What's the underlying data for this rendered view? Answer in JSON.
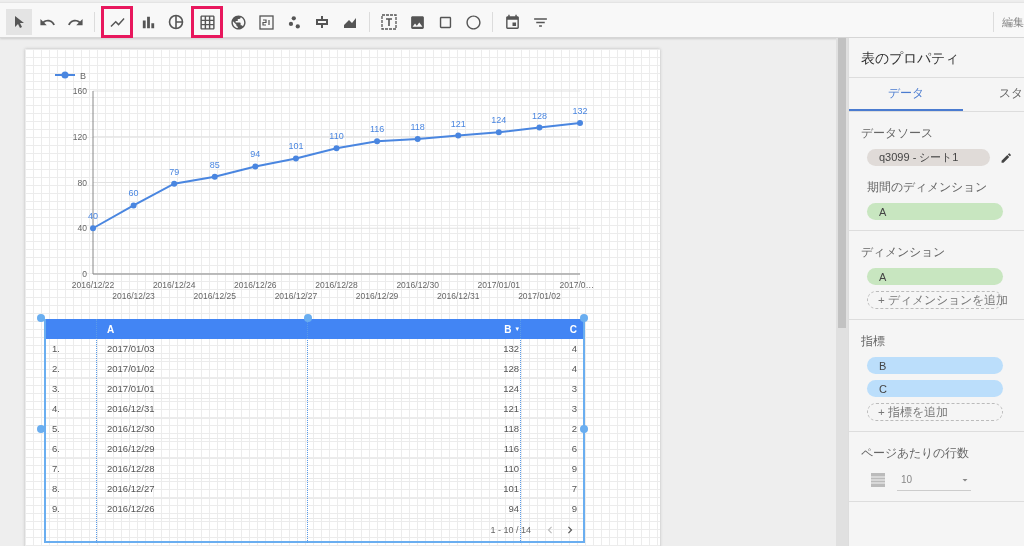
{
  "toolbar": {
    "groups": [
      [
        {
          "kind": "pointer",
          "selected": true,
          "highlighted": false
        },
        {
          "kind": "undo",
          "selected": false,
          "highlighted": false
        },
        {
          "kind": "redo",
          "selected": false,
          "highlighted": false
        }
      ],
      [
        {
          "kind": "line",
          "selected": false,
          "highlighted": true
        },
        {
          "kind": "bar",
          "selected": false,
          "highlighted": false
        },
        {
          "kind": "pie",
          "selected": false,
          "highlighted": false
        },
        {
          "kind": "table",
          "selected": false,
          "highlighted": true
        },
        {
          "kind": "geo",
          "selected": false,
          "highlighted": false
        },
        {
          "kind": "scorecard",
          "selected": false,
          "highlighted": false
        },
        {
          "kind": "scatter",
          "selected": false,
          "highlighted": false
        },
        {
          "kind": "bullet",
          "selected": false,
          "highlighted": false
        },
        {
          "kind": "area",
          "selected": false,
          "highlighted": false
        }
      ],
      [
        {
          "kind": "text",
          "selected": false,
          "highlighted": false
        },
        {
          "kind": "image",
          "selected": false,
          "highlighted": false
        },
        {
          "kind": "rectangle",
          "selected": false,
          "highlighted": false
        },
        {
          "kind": "circle",
          "selected": false,
          "highlighted": false
        }
      ],
      [
        {
          "kind": "date",
          "selected": false,
          "highlighted": false
        },
        {
          "kind": "filter",
          "selected": false,
          "highlighted": false
        }
      ]
    ],
    "edit_label": "編集"
  },
  "chart": {
    "chart_data": {
      "type": "line",
      "categories": [
        "2016/12/22",
        "2016/12/23",
        "2016/12/24",
        "2016/12/25",
        "2016/12/26",
        "2016/12/27",
        "2016/12/28",
        "2016/12/29",
        "2016/12/30",
        "2016/12/31",
        "2017/01/01",
        "2017/01/02",
        "2017/0…"
      ],
      "series": [
        {
          "name": "B",
          "color": "#4a86e0",
          "values": [
            40,
            60,
            79,
            85,
            94,
            101,
            110,
            116,
            118,
            121,
            124,
            128,
            132
          ]
        }
      ],
      "yticks": [
        0,
        40,
        80,
        120,
        160
      ],
      "ylim": [
        0,
        160
      ],
      "data_labels": true,
      "grid": true,
      "marker": true
    }
  },
  "table": {
    "columns": [
      "",
      "A",
      "B",
      "C"
    ],
    "sort_mark": "▾",
    "rows": [
      [
        "1.",
        "2017/01/03",
        "132",
        "4"
      ],
      [
        "2.",
        "2017/01/02",
        "128",
        "4"
      ],
      [
        "3.",
        "2017/01/01",
        "124",
        "3"
      ],
      [
        "4.",
        "2016/12/31",
        "121",
        "3"
      ],
      [
        "5.",
        "2016/12/30",
        "118",
        "2"
      ],
      [
        "6.",
        "2016/12/29",
        "116",
        "6"
      ],
      [
        "7.",
        "2016/12/28",
        "110",
        "9"
      ],
      [
        "8.",
        "2016/12/27",
        "101",
        "7"
      ],
      [
        "9.",
        "2016/12/26",
        "94",
        "9"
      ]
    ],
    "pagination": "1 - 10 / 14"
  },
  "panel": {
    "title": "表のプロパティ",
    "tabs": [
      {
        "label": "データ",
        "selected": true
      },
      {
        "label": "スタ",
        "selected": false
      }
    ],
    "data_source": {
      "label": "データソース",
      "value": "q3099 - シート1",
      "period_label": "期間のディメンション",
      "period_chip": "A"
    },
    "dimensions": {
      "label": "ディメンション",
      "chips": [
        "A"
      ],
      "add": "+ ディメンションを追加"
    },
    "metrics": {
      "label": "指標",
      "chips": [
        "B",
        "C"
      ],
      "add": "+ 指標を追加"
    },
    "rows_per_page": {
      "label": "ページあたりの行数",
      "value": "10"
    }
  }
}
